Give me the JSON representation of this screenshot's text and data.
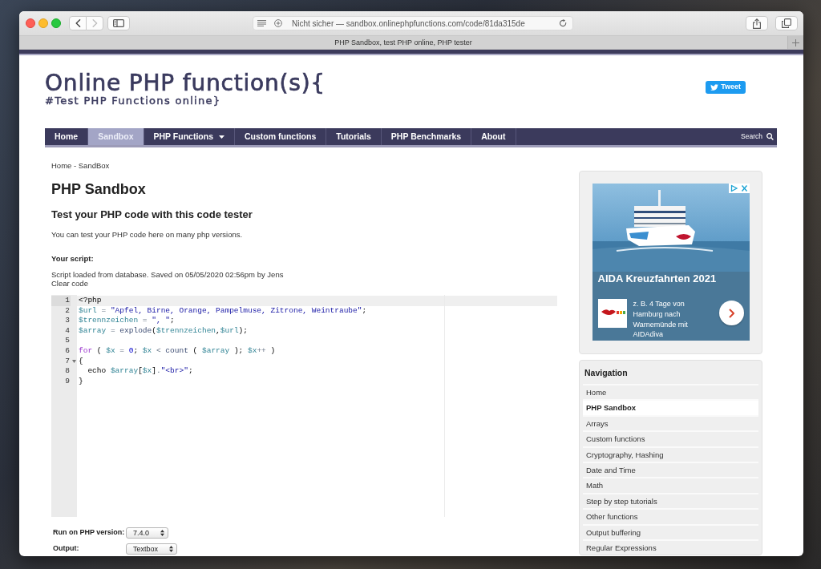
{
  "browser": {
    "nav_buttons": [
      {
        "kind": "back",
        "disabled": false
      },
      {
        "kind": "forward",
        "disabled": true
      }
    ],
    "url": "Nicht sicher — sandbox.onlinephpfunctions.com/code/81da315de",
    "tab_title": "PHP Sandbox, test PHP online, PHP tester"
  },
  "header": {
    "logo": "Online PHP function(s){",
    "tagline": "#Test PHP Functions online}",
    "tweet": "Tweet"
  },
  "nav": {
    "items": [
      {
        "label": "Home",
        "selected": false,
        "dropdown": false
      },
      {
        "label": "Sandbox",
        "selected": true,
        "dropdown": false
      },
      {
        "label": "PHP Functions",
        "selected": false,
        "dropdown": true
      },
      {
        "label": "Custom functions",
        "selected": false,
        "dropdown": false
      },
      {
        "label": "Tutorials",
        "selected": false,
        "dropdown": false
      },
      {
        "label": "PHP Benchmarks",
        "selected": false,
        "dropdown": false
      },
      {
        "label": "About",
        "selected": false,
        "dropdown": false
      }
    ],
    "search": "Search"
  },
  "content": {
    "breadcrumb": "Home - SandBox",
    "title": "PHP Sandbox",
    "subtitle": "Test your PHP code with this code tester",
    "intro": "You can test your PHP code here on many php versions.",
    "script_label": "Your script:",
    "script_info": "Script loaded from database. Saved on 05/05/2020 02:56pm by Jens",
    "clear_code": "Clear code"
  },
  "editor": {
    "lines": [
      {
        "number": "1",
        "current": true,
        "foldable": false,
        "tokens": [
          {
            "kind": "text",
            "text": "<?php"
          }
        ]
      },
      {
        "number": "2",
        "current": false,
        "foldable": false,
        "tokens": [
          {
            "kind": "variable",
            "text": "$url"
          },
          {
            "kind": "operator",
            "text": " = "
          },
          {
            "kind": "string",
            "text": "\"Apfel, Birne, Orange, Pampelmuse, Zitrone, Weintraube\""
          },
          {
            "kind": "text",
            "text": ";"
          }
        ]
      },
      {
        "number": "3",
        "current": false,
        "foldable": false,
        "tokens": [
          {
            "kind": "variable",
            "text": "$trennzeichen"
          },
          {
            "kind": "operator",
            "text": " = "
          },
          {
            "kind": "string",
            "text": "\", \""
          },
          {
            "kind": "text",
            "text": ";"
          }
        ]
      },
      {
        "number": "4",
        "current": false,
        "foldable": false,
        "tokens": [
          {
            "kind": "variable",
            "text": "$array"
          },
          {
            "kind": "operator",
            "text": " = "
          },
          {
            "kind": "function",
            "text": "explode"
          },
          {
            "kind": "text",
            "text": "("
          },
          {
            "kind": "variable",
            "text": "$trennzeichen"
          },
          {
            "kind": "text",
            "text": ","
          },
          {
            "kind": "variable",
            "text": "$url"
          },
          {
            "kind": "text",
            "text": ");"
          }
        ]
      },
      {
        "number": "5",
        "current": false,
        "foldable": false
      },
      {
        "number": "6",
        "current": false,
        "foldable": false,
        "tokens": [
          {
            "kind": "keyword",
            "text": "for"
          },
          {
            "kind": "text",
            "text": " ( "
          },
          {
            "kind": "variable",
            "text": "$x"
          },
          {
            "kind": "operator",
            "text": " = "
          },
          {
            "kind": "number",
            "text": "0"
          },
          {
            "kind": "text",
            "text": "; "
          },
          {
            "kind": "variable",
            "text": "$x"
          },
          {
            "kind": "operator",
            "text": " < "
          },
          {
            "kind": "function",
            "text": "count"
          },
          {
            "kind": "text",
            "text": " ( "
          },
          {
            "kind": "variable",
            "text": "$array"
          },
          {
            "kind": "text",
            "text": " ); "
          },
          {
            "kind": "variable",
            "text": "$x"
          },
          {
            "kind": "operator",
            "text": "++"
          },
          {
            "kind": "text",
            "text": " )"
          }
        ]
      },
      {
        "number": "7",
        "current": false,
        "foldable": true,
        "tokens": [
          {
            "kind": "text",
            "text": "{"
          }
        ]
      },
      {
        "number": "8",
        "current": false,
        "foldable": false,
        "tokens": [
          {
            "kind": "text",
            "text": "  echo "
          },
          {
            "kind": "variable",
            "text": "$array"
          },
          {
            "kind": "text",
            "text": "["
          },
          {
            "kind": "variable",
            "text": "$x"
          },
          {
            "kind": "text",
            "text": "]"
          },
          {
            "kind": "operator",
            "text": "."
          },
          {
            "kind": "string",
            "text": "\"<br>\""
          },
          {
            "kind": "text",
            "text": ";"
          }
        ]
      },
      {
        "number": "9",
        "current": false,
        "foldable": false,
        "tokens": [
          {
            "kind": "text",
            "text": "}"
          }
        ]
      }
    ]
  },
  "options": [
    {
      "label": "Run on PHP version:",
      "value": "7.4.0"
    },
    {
      "label": "Output:",
      "value": "Textbox"
    }
  ],
  "ad": {
    "title": "AIDA Kreuzfahrten 2021",
    "text": "z. B. 4 Tage von Hamburg nach Warnemünde mit AIDAdiva"
  },
  "sidebar_nav": {
    "title": "Navigation",
    "items": [
      {
        "label": "Home",
        "selected": false
      },
      {
        "label": "PHP Sandbox",
        "selected": true
      },
      {
        "label": "Arrays",
        "selected": false
      },
      {
        "label": "Custom functions",
        "selected": false
      },
      {
        "label": "Cryptography, Hashing",
        "selected": false
      },
      {
        "label": "Date and Time",
        "selected": false
      },
      {
        "label": "Math",
        "selected": false
      },
      {
        "label": "Step by step tutorials",
        "selected": false
      },
      {
        "label": "Other functions",
        "selected": false
      },
      {
        "label": "Output buffering",
        "selected": false
      },
      {
        "label": "Regular Expressions",
        "selected": false
      }
    ]
  }
}
